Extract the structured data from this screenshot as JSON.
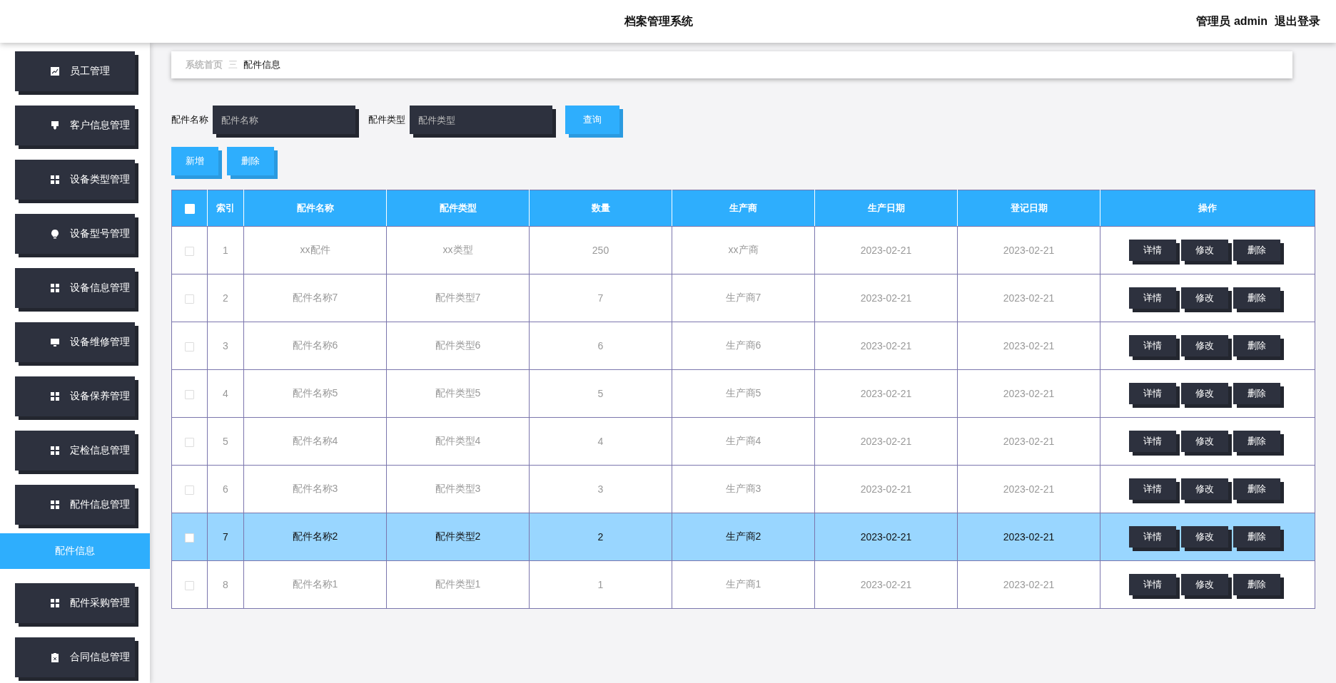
{
  "header": {
    "title": "档案管理系统",
    "user": "管理员 admin",
    "logout": "退出登录"
  },
  "sidebar": {
    "items": [
      {
        "label": "员工管理"
      },
      {
        "label": "客户信息管理"
      },
      {
        "label": "设备类型管理"
      },
      {
        "label": "设备型号管理"
      },
      {
        "label": "设备信息管理"
      },
      {
        "label": "设备维修管理"
      },
      {
        "label": "设备保养管理"
      },
      {
        "label": "定检信息管理"
      },
      {
        "label": "配件信息管理",
        "children": [
          {
            "label": "配件信息",
            "selected": true
          }
        ]
      },
      {
        "label": "配件采购管理"
      },
      {
        "label": "合同信息管理"
      }
    ]
  },
  "breadcrumb": {
    "home": "系统首页",
    "separator": "三",
    "current": "配件信息"
  },
  "search": {
    "fields": [
      {
        "label": "配件名称",
        "placeholder": "配件名称"
      },
      {
        "label": "配件类型",
        "placeholder": "配件类型"
      }
    ],
    "button": "查询"
  },
  "actions": [
    "新增",
    "删除"
  ],
  "table": {
    "header_checked": false,
    "columns": [
      "索引",
      "配件名称",
      "配件类型",
      "数量",
      "生产商",
      "生产日期",
      "登记日期",
      "操作"
    ],
    "rows": [
      {
        "selected": false,
        "cells": [
          "1",
          "xx配件",
          "xx类型",
          "250",
          "xx产商",
          "2023-02-21",
          "2023-02-21"
        ],
        "actions": [
          "详情",
          "修改",
          "删除"
        ]
      },
      {
        "selected": false,
        "cells": [
          "2",
          "配件名称7",
          "配件类型7",
          "7",
          "生产商7",
          "2023-02-21",
          "2023-02-21"
        ],
        "actions": [
          "详情",
          "修改",
          "删除"
        ]
      },
      {
        "selected": false,
        "cells": [
          "3",
          "配件名称6",
          "配件类型6",
          "6",
          "生产商6",
          "2023-02-21",
          "2023-02-21"
        ],
        "actions": [
          "详情",
          "修改",
          "删除"
        ]
      },
      {
        "selected": false,
        "cells": [
          "4",
          "配件名称5",
          "配件类型5",
          "5",
          "生产商5",
          "2023-02-21",
          "2023-02-21"
        ],
        "actions": [
          "详情",
          "修改",
          "删除"
        ]
      },
      {
        "selected": false,
        "cells": [
          "5",
          "配件名称4",
          "配件类型4",
          "4",
          "生产商4",
          "2023-02-21",
          "2023-02-21"
        ],
        "actions": [
          "详情",
          "修改",
          "删除"
        ]
      },
      {
        "selected": false,
        "cells": [
          "6",
          "配件名称3",
          "配件类型3",
          "3",
          "生产商3",
          "2023-02-21",
          "2023-02-21"
        ],
        "actions": [
          "详情",
          "修改",
          "删除"
        ]
      },
      {
        "selected": true,
        "cells": [
          "7",
          "配件名称2",
          "配件类型2",
          "2",
          "生产商2",
          "2023-02-21",
          "2023-02-21"
        ],
        "actions": [
          "详情",
          "修改",
          "删除"
        ]
      },
      {
        "selected": false,
        "cells": [
          "8",
          "配件名称1",
          "配件类型1",
          "1",
          "生产商1",
          "2023-02-21",
          "2023-02-21"
        ],
        "actions": [
          "详情",
          "修改",
          "删除"
        ]
      }
    ]
  }
}
